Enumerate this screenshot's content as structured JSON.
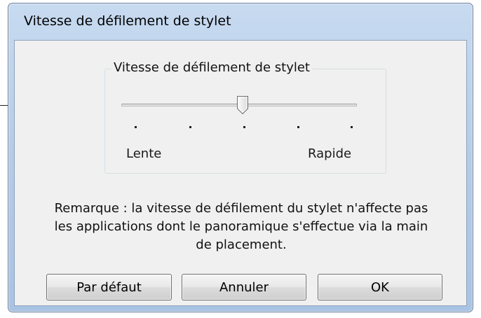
{
  "window": {
    "title": "Vitesse de défilement de stylet"
  },
  "group": {
    "label": "Vitesse de défilement de stylet"
  },
  "slider": {
    "min_label": "Lente",
    "max_label": "Rapide",
    "tick_count": 5,
    "selected_tick": 3
  },
  "note": {
    "line1": "Remarque : la vitesse de défilement du stylet n'affecte pas",
    "line2": "les applications dont le panoramique s'effectue via la main",
    "line3": "de placement."
  },
  "buttons": {
    "default_label": "Par défaut",
    "cancel_label": "Annuler",
    "ok_label": "OK"
  }
}
